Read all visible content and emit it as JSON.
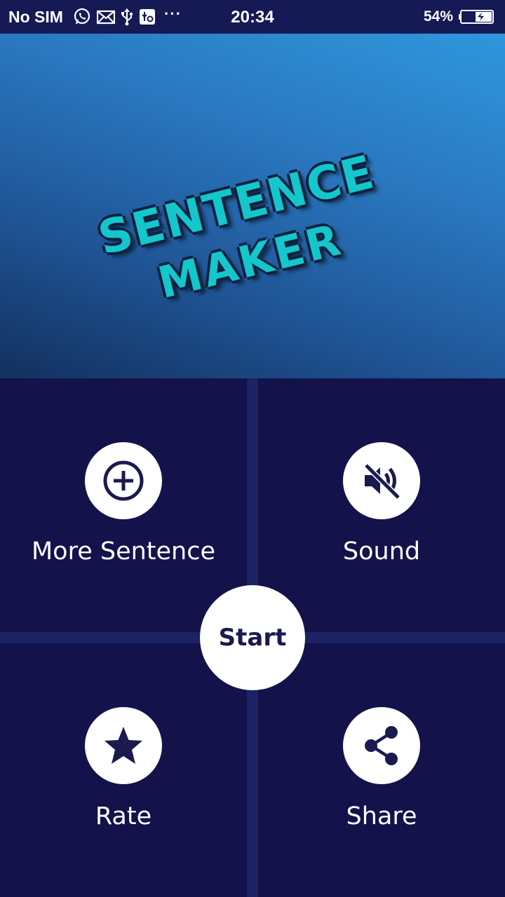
{
  "status_bar": {
    "carrier": "No SIM",
    "time": "20:34",
    "battery_percent": "54%",
    "more_icons": "···",
    "icons": [
      "whatsapp-icon",
      "mail-icon",
      "usb-icon",
      "usb-debug-icon"
    ]
  },
  "banner": {
    "title_line1": "Sentence",
    "title_line2": "Maker"
  },
  "menu": {
    "more_sentence_label": "More Sentence",
    "sound_label": "Sound",
    "rate_label": "Rate",
    "share_label": "Share",
    "start_label": "Start"
  },
  "colors": {
    "tile": "#13124a",
    "divider": "#1b2364",
    "title_text": "#13c7cc",
    "icon": "#1b1a4f"
  }
}
